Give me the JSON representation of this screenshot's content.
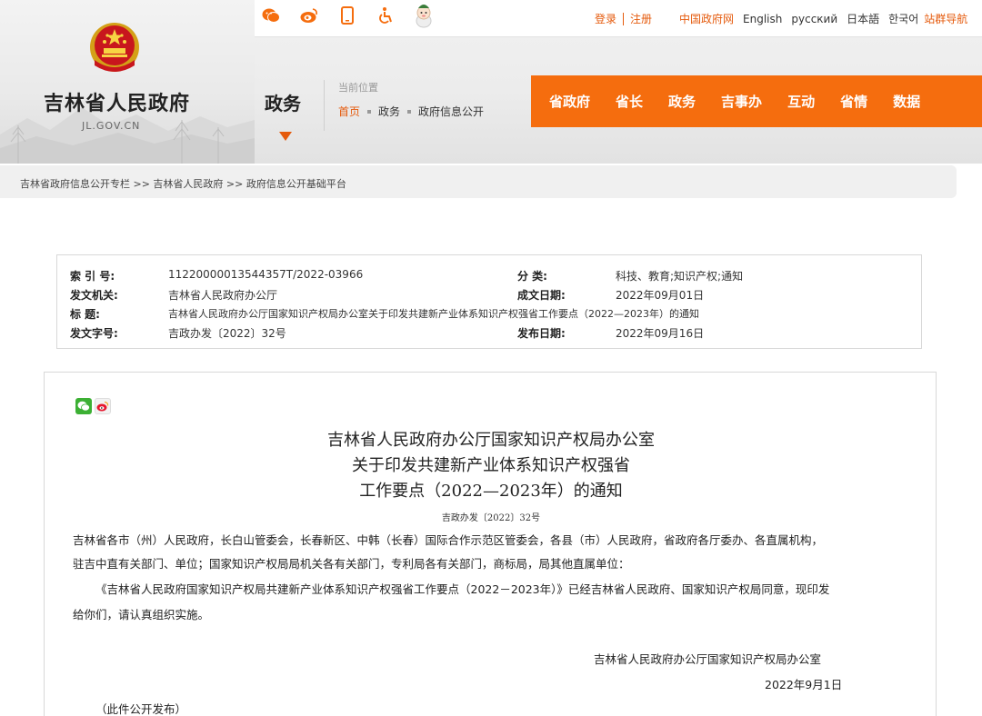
{
  "site": {
    "name": "吉林省人民政府",
    "domain": "JL.GOV.CN",
    "section": "政务"
  },
  "top_icons": [
    "weibo-wechat-icon",
    "weibo-icon",
    "mobile-icon",
    "accessibility-icon",
    "mascot-icon"
  ],
  "top_links": {
    "login": "登录",
    "register": "注册",
    "gov_cn": "中国政府网",
    "english": "English",
    "russian": "русский",
    "japanese": "日本語",
    "korean": "한국어",
    "site_nav": "站群导航"
  },
  "location": {
    "label": "当前位置",
    "crumbs": [
      "首页",
      "政务",
      "政府信息公开"
    ]
  },
  "main_nav": [
    "省政府",
    "省长",
    "政务",
    "吉事办",
    "互动",
    "省情",
    "数据"
  ],
  "breadcrumb": "吉林省政府信息公开专栏 >> 吉林省人民政府 >> 政府信息公开基础平台",
  "meta": {
    "index_label": "索 引 号:",
    "index_value": "11220000013544357T/2022-03966",
    "category_label": "分    类:",
    "category_value": "科技、教育;知识产权;通知",
    "issuer_label": "发文机关:",
    "issuer_value": "吉林省人民政府办公厅",
    "date_written_label": "成文日期:",
    "date_written_value": "2022年09月01日",
    "title_label": "标    题:",
    "title_value": "吉林省人民政府办公厅国家知识产权局办公室关于印发共建新产业体系知识产权强省工作要点（2022—2023年）的通知",
    "doc_no_label": "发文字号:",
    "doc_no_value": "吉政办发〔2022〕32号",
    "published_label": "发布日期:",
    "published_value": "2022年09月16日"
  },
  "document": {
    "title_line1": "吉林省人民政府办公厅国家知识产权局办公室",
    "title_line2": "关于印发共建新产业体系知识产权强省",
    "title_line3": "工作要点（2022—2023年）的通知",
    "doc_number": "吉政办发〔2022〕32号",
    "para1_line1": "吉林省各市（州）人民政府，长白山管委会，长春新区、中韩（长春）国际合作示范区管委会，各县（市）人民政府，省政府各厅委办、各直属机构，",
    "para1_line2": "驻吉中直有关部门、单位；国家知识产权局局机关各有关部门，专利局各有关部门，商标局，局其他直属单位：",
    "para2_line1": "《吉林省人民政府国家知识产权局共建新产业体系知识产权强省工作要点（2022－2023年）》已经吉林省人民政府、国家知识产权局同意，现印发",
    "para2_line2": "给你们，请认真组织实施。",
    "signer": "吉林省人民政府办公厅国家知识产权局办公室",
    "sign_date": "2022年9月1日",
    "note": "（此件公开发布）"
  },
  "colors": {
    "accent": "#f56d0e",
    "accent_text": "#e55a0c"
  }
}
